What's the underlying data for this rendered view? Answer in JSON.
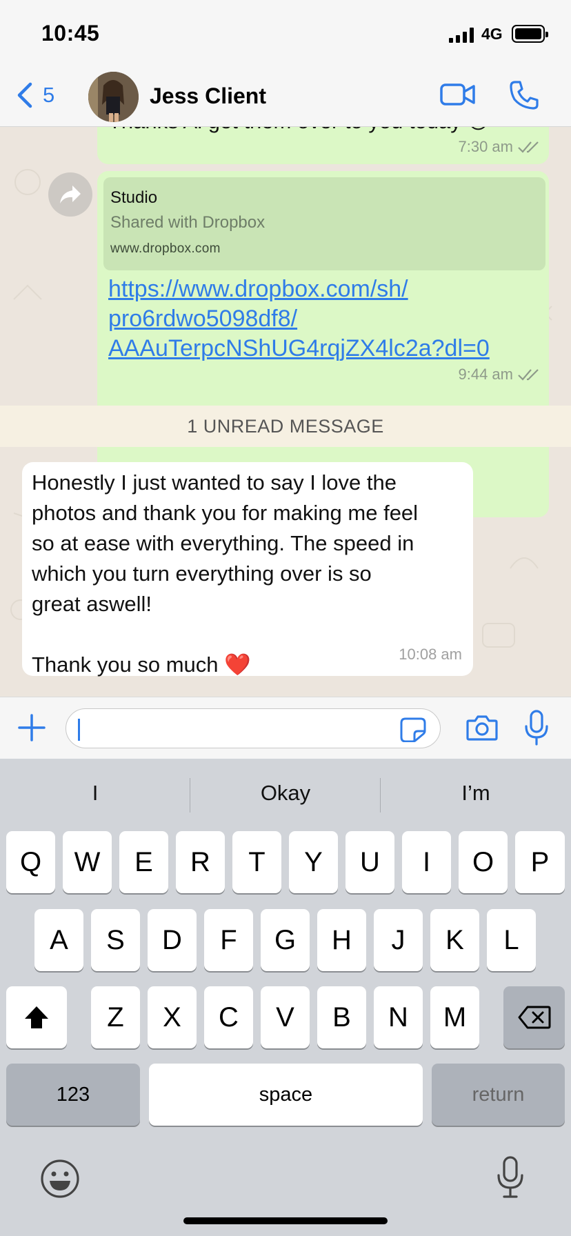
{
  "status_bar": {
    "time": "10:45",
    "network": "4G"
  },
  "header": {
    "back_count": "5",
    "contact_name": "Jess Client",
    "accent_color": "#2f7ce8"
  },
  "chat": {
    "previous_message": {
      "partial_text": "Thanks Al get them over to you today 😊",
      "time": "7:30 am"
    },
    "link_message": {
      "preview_title": "Studio",
      "preview_subtitle": "Shared with Dropbox",
      "preview_domain": "www.dropbox.com",
      "url": "https://www.dropbox.com/sh/pro6rdwo5098df8/AAAuTerpcNShUG4rqjZX4lc2a?dl=0",
      "url_line_1": "https://www.dropbox.com/sh/",
      "url_line_2": "pro6rdwo5098df8/",
      "url_line_3": "AAAuTerpcNShUG4rqjZX4lc2a?dl=0",
      "time": "9:44 am"
    },
    "unread_banner": "1 UNREAD MESSAGE",
    "incoming_message": {
      "text": "Honestly I just wanted to say I love the\nphotos and thank you for making me feel\nso at ease with everything. The speed in\nwhich you turn everything over is so\ngreat aswell!\n\nThank you so much ❤️",
      "time": "10:08 am"
    }
  },
  "composer": {
    "input_value": "",
    "icons": [
      "plus-icon",
      "sticker-icon",
      "camera-icon",
      "microphone-icon"
    ]
  },
  "keyboard": {
    "suggestions": [
      "I",
      "Okay",
      "I’m"
    ],
    "row1": [
      "Q",
      "W",
      "E",
      "R",
      "T",
      "Y",
      "U",
      "I",
      "O",
      "P"
    ],
    "row2": [
      "A",
      "S",
      "D",
      "F",
      "G",
      "H",
      "J",
      "K",
      "L"
    ],
    "row3": [
      "Z",
      "X",
      "C",
      "V",
      "B",
      "N",
      "M"
    ],
    "numbers_key": "123",
    "space_key": "space",
    "return_key": "return"
  }
}
